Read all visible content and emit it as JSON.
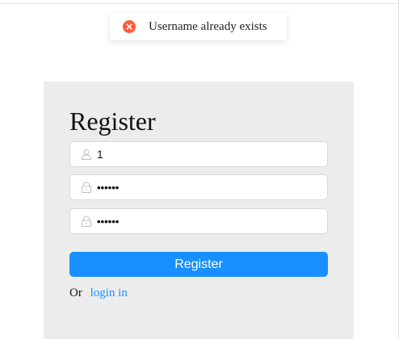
{
  "toast": {
    "icon": "error-circle-icon",
    "color": "#ff5b3a",
    "message": "Username already exists"
  },
  "form": {
    "title": "Register",
    "username": {
      "icon": "user-icon",
      "value": "1"
    },
    "password": {
      "icon": "lock-icon",
      "value": "••••••"
    },
    "confirm_password": {
      "icon": "lock-icon",
      "value": "••••••"
    },
    "submit_label": "Register",
    "alt_prefix": "Or",
    "alt_link": "login in"
  },
  "colors": {
    "accent": "#1890ff",
    "panel_bg": "#ececec"
  }
}
